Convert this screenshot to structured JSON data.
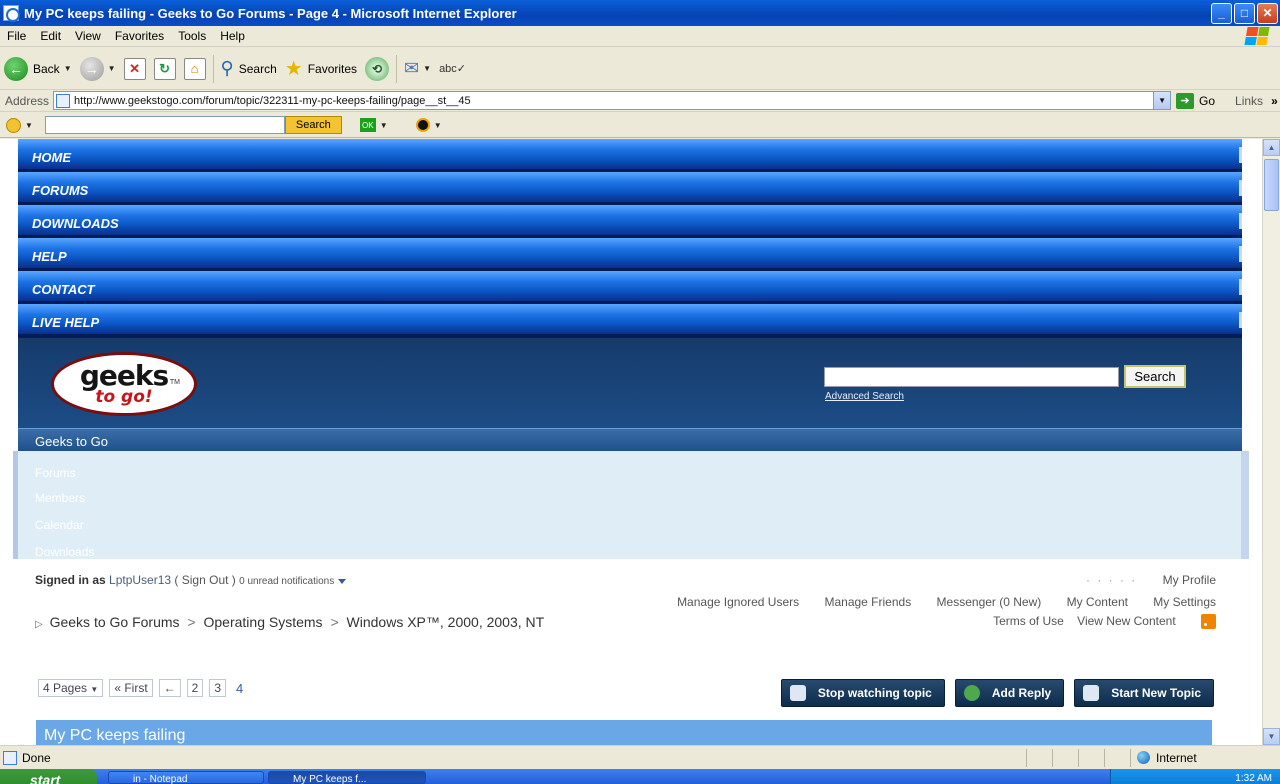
{
  "window": {
    "title": "My PC keeps failing - Geeks to Go Forums - Page 4 - Microsoft Internet Explorer",
    "minimize": "_",
    "maximize": "□",
    "close": "✕"
  },
  "menubar": [
    "File",
    "Edit",
    "View",
    "Favorites",
    "Tools",
    "Help"
  ],
  "toolbar": {
    "back_label": "Back",
    "search_label": "Search",
    "favorites_label": "Favorites"
  },
  "address": {
    "label": "Address",
    "url": "http://www.geekstogo.com/forum/topic/322311-my-pc-keeps-failing/page__st__45",
    "go_label": "Go",
    "links_label": "Links"
  },
  "search_toolbar": {
    "input_value": "",
    "button_label": "Search",
    "ok_label": "OK"
  },
  "site_nav": [
    "HOME",
    "FORUMS",
    "DOWNLOADS",
    "HELP",
    "CONTACT",
    "LIVE HELP"
  ],
  "header": {
    "logo_line1": "geeks",
    "logo_line2": "to go!",
    "logo_tm": "TM",
    "search_button": "Search",
    "advanced_search": "Advanced Search"
  },
  "crumb_bar": {
    "label": "Geeks to Go"
  },
  "side_links": [
    "Forums",
    "Members",
    "Calendar",
    "Downloads"
  ],
  "user": {
    "signed_in_as": "Signed in as",
    "username": "LptpUser13",
    "sign_out": "( Sign Out )",
    "notifications": "0 unread notifications",
    "dots": "· · · · ·",
    "my_profile": "My Profile",
    "links_row": [
      "Manage Ignored Users",
      "Manage Friends",
      "Messenger (0 New)",
      "My Content",
      "My Settings"
    ],
    "terms": "Terms of Use",
    "view_new": "View New Content"
  },
  "breadcrumbs": {
    "marker": "▷",
    "items": [
      "Geeks to Go Forums",
      "Operating Systems",
      "Windows XP™, 2000, 2003, NT"
    ],
    "separator": ">"
  },
  "pagination": {
    "pages_label": "4 Pages",
    "first": "« First",
    "prev": "←",
    "pages": [
      "2",
      "3"
    ],
    "current": "4"
  },
  "topic_buttons": {
    "stop_watching": "Stop watching topic",
    "add_reply": "Add Reply",
    "start_new": "Start New Topic"
  },
  "topic": {
    "title": "My PC keeps failing"
  },
  "status": {
    "text": "Done",
    "zone": "Internet"
  },
  "taskbar": {
    "start": "start",
    "tasks": [
      "in - Notepad",
      "My PC keeps f..."
    ],
    "clock": "1:32 AM"
  }
}
